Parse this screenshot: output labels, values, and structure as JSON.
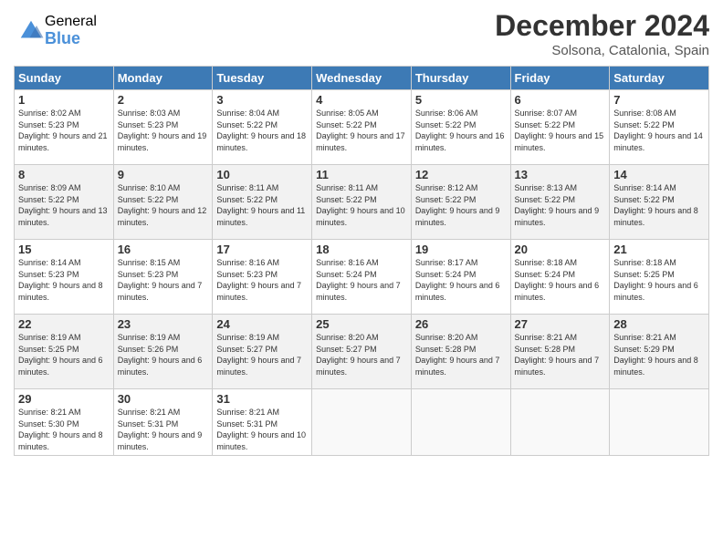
{
  "logo": {
    "general": "General",
    "blue": "Blue"
  },
  "header": {
    "month": "December 2024",
    "location": "Solsona, Catalonia, Spain"
  },
  "weekdays": [
    "Sunday",
    "Monday",
    "Tuesday",
    "Wednesday",
    "Thursday",
    "Friday",
    "Saturday"
  ],
  "weeks": [
    [
      {
        "day": 1,
        "sunrise": "8:02 AM",
        "sunset": "5:23 PM",
        "daylight": "9 hours and 21 minutes."
      },
      {
        "day": 2,
        "sunrise": "8:03 AM",
        "sunset": "5:23 PM",
        "daylight": "9 hours and 19 minutes."
      },
      {
        "day": 3,
        "sunrise": "8:04 AM",
        "sunset": "5:22 PM",
        "daylight": "9 hours and 18 minutes."
      },
      {
        "day": 4,
        "sunrise": "8:05 AM",
        "sunset": "5:22 PM",
        "daylight": "9 hours and 17 minutes."
      },
      {
        "day": 5,
        "sunrise": "8:06 AM",
        "sunset": "5:22 PM",
        "daylight": "9 hours and 16 minutes."
      },
      {
        "day": 6,
        "sunrise": "8:07 AM",
        "sunset": "5:22 PM",
        "daylight": "9 hours and 15 minutes."
      },
      {
        "day": 7,
        "sunrise": "8:08 AM",
        "sunset": "5:22 PM",
        "daylight": "9 hours and 14 minutes."
      }
    ],
    [
      {
        "day": 8,
        "sunrise": "8:09 AM",
        "sunset": "5:22 PM",
        "daylight": "9 hours and 13 minutes."
      },
      {
        "day": 9,
        "sunrise": "8:10 AM",
        "sunset": "5:22 PM",
        "daylight": "9 hours and 12 minutes."
      },
      {
        "day": 10,
        "sunrise": "8:11 AM",
        "sunset": "5:22 PM",
        "daylight": "9 hours and 11 minutes."
      },
      {
        "day": 11,
        "sunrise": "8:11 AM",
        "sunset": "5:22 PM",
        "daylight": "9 hours and 10 minutes."
      },
      {
        "day": 12,
        "sunrise": "8:12 AM",
        "sunset": "5:22 PM",
        "daylight": "9 hours and 9 minutes."
      },
      {
        "day": 13,
        "sunrise": "8:13 AM",
        "sunset": "5:22 PM",
        "daylight": "9 hours and 9 minutes."
      },
      {
        "day": 14,
        "sunrise": "8:14 AM",
        "sunset": "5:22 PM",
        "daylight": "9 hours and 8 minutes."
      }
    ],
    [
      {
        "day": 15,
        "sunrise": "8:14 AM",
        "sunset": "5:23 PM",
        "daylight": "9 hours and 8 minutes."
      },
      {
        "day": 16,
        "sunrise": "8:15 AM",
        "sunset": "5:23 PM",
        "daylight": "9 hours and 7 minutes."
      },
      {
        "day": 17,
        "sunrise": "8:16 AM",
        "sunset": "5:23 PM",
        "daylight": "9 hours and 7 minutes."
      },
      {
        "day": 18,
        "sunrise": "8:16 AM",
        "sunset": "5:24 PM",
        "daylight": "9 hours and 7 minutes."
      },
      {
        "day": 19,
        "sunrise": "8:17 AM",
        "sunset": "5:24 PM",
        "daylight": "9 hours and 6 minutes."
      },
      {
        "day": 20,
        "sunrise": "8:18 AM",
        "sunset": "5:24 PM",
        "daylight": "9 hours and 6 minutes."
      },
      {
        "day": 21,
        "sunrise": "8:18 AM",
        "sunset": "5:25 PM",
        "daylight": "9 hours and 6 minutes."
      }
    ],
    [
      {
        "day": 22,
        "sunrise": "8:19 AM",
        "sunset": "5:25 PM",
        "daylight": "9 hours and 6 minutes."
      },
      {
        "day": 23,
        "sunrise": "8:19 AM",
        "sunset": "5:26 PM",
        "daylight": "9 hours and 6 minutes."
      },
      {
        "day": 24,
        "sunrise": "8:19 AM",
        "sunset": "5:27 PM",
        "daylight": "9 hours and 7 minutes."
      },
      {
        "day": 25,
        "sunrise": "8:20 AM",
        "sunset": "5:27 PM",
        "daylight": "9 hours and 7 minutes."
      },
      {
        "day": 26,
        "sunrise": "8:20 AM",
        "sunset": "5:28 PM",
        "daylight": "9 hours and 7 minutes."
      },
      {
        "day": 27,
        "sunrise": "8:21 AM",
        "sunset": "5:28 PM",
        "daylight": "9 hours and 7 minutes."
      },
      {
        "day": 28,
        "sunrise": "8:21 AM",
        "sunset": "5:29 PM",
        "daylight": "9 hours and 8 minutes."
      }
    ],
    [
      {
        "day": 29,
        "sunrise": "8:21 AM",
        "sunset": "5:30 PM",
        "daylight": "9 hours and 8 minutes."
      },
      {
        "day": 30,
        "sunrise": "8:21 AM",
        "sunset": "5:31 PM",
        "daylight": "9 hours and 9 minutes."
      },
      {
        "day": 31,
        "sunrise": "8:21 AM",
        "sunset": "5:31 PM",
        "daylight": "9 hours and 10 minutes."
      },
      null,
      null,
      null,
      null
    ]
  ]
}
